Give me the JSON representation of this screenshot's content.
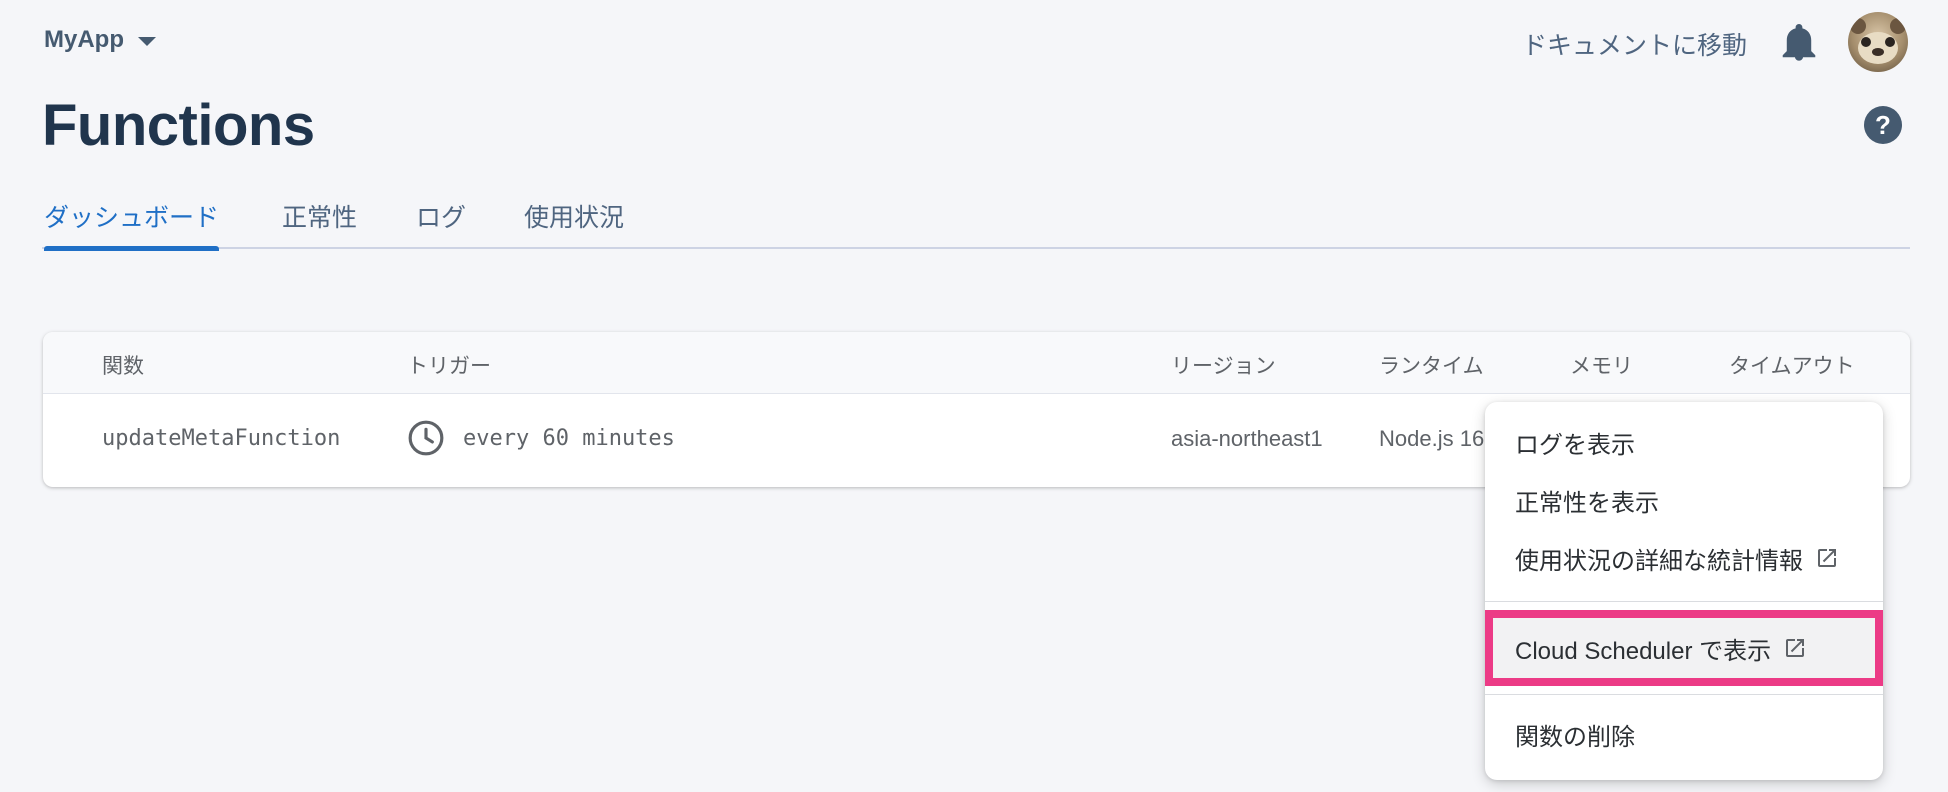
{
  "header": {
    "project_name": "MyApp",
    "docs_link": "ドキュメントに移動"
  },
  "page": {
    "title": "Functions",
    "help_glyph": "?"
  },
  "tabs": [
    {
      "label": "ダッシュボード",
      "active": true
    },
    {
      "label": "正常性",
      "active": false
    },
    {
      "label": "ログ",
      "active": false
    },
    {
      "label": "使用状況",
      "active": false
    }
  ],
  "table": {
    "columns": [
      "関数",
      "トリガー",
      "リージョン",
      "ランタイム",
      "メモリ",
      "タイムアウト"
    ],
    "rows": [
      {
        "function": "updateMetaFunction",
        "trigger": "every 60 minutes",
        "region": "asia-northeast1",
        "runtime": "Node.js 16"
      }
    ]
  },
  "context_menu": {
    "items": [
      {
        "label": "ログを表示",
        "external": false
      },
      {
        "label": "正常性を表示",
        "external": false
      },
      {
        "label": "使用状況の詳細な統計情報",
        "external": true
      },
      {
        "label": "Cloud Scheduler で表示",
        "external": true,
        "highlighted": true
      },
      {
        "label": "関数の削除",
        "external": false
      }
    ]
  },
  "colors": {
    "accent": "#1f6fc6",
    "highlight_border": "#ec3b86",
    "title": "#20354d"
  },
  "icons": [
    "chevron-down-icon",
    "bell-icon",
    "avatar",
    "help-icon",
    "clock-icon",
    "external-link-icon"
  ]
}
